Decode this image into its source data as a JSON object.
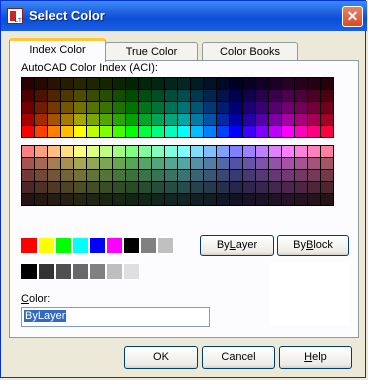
{
  "window": {
    "title": "Select Color",
    "close_glyph": "✕"
  },
  "tabs": [
    {
      "label": "Index Color",
      "active": true
    },
    {
      "label": "True Color",
      "active": false
    },
    {
      "label": "Color Books",
      "active": false
    }
  ],
  "panel": {
    "aci_label": "AutoCAD Color Index (ACI):",
    "bylayer_button": {
      "prefix": "By",
      "underline": "L",
      "suffix": "ayer"
    },
    "byblock_button": {
      "prefix": "By",
      "underline": "B",
      "suffix": "lock"
    },
    "color_label": {
      "underline": "C",
      "suffix": "olor:"
    },
    "color_value": "ByLayer"
  },
  "standard_colors": [
    "#ff0000",
    "#ffff00",
    "#00ff00",
    "#00ffff",
    "#0000ff",
    "#ff00ff",
    "#000000",
    "#808080",
    "#c0c0c0"
  ],
  "gray_colors": [
    "#000000",
    "#333333",
    "#505050",
    "#696969",
    "#808080",
    "#bebebe",
    "#dfdfdf"
  ],
  "buttons": {
    "ok": {
      "underline": "",
      "label": "OK"
    },
    "cancel": {
      "underline": "",
      "label": "Cancel"
    },
    "help": {
      "underline": "H",
      "suffix": "elp"
    }
  }
}
